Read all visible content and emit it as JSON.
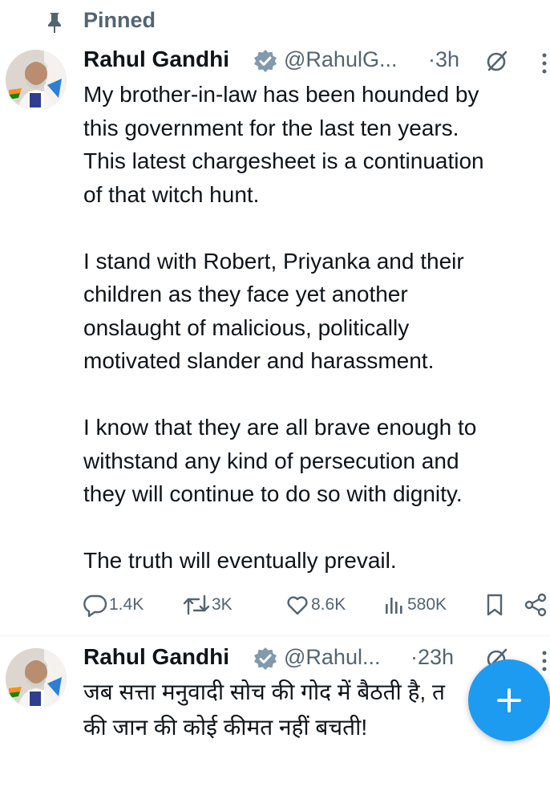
{
  "pinned_label": "Pinned",
  "tweets": [
    {
      "author_name": "Rahul Gandhi",
      "handle": "@RahulG...",
      "time": "·3h",
      "text": "My brother-in-law has been hounded by\nthis government for the last ten years.\nThis latest chargesheet is a continuation\nof that witch hunt.\n\nI stand with Robert, Priyanka and their\nchildren as they face yet another\nonslaught of malicious, politically\nmotivated slander and harassment.\n\nI know that they are all brave enough to\nwithstand any kind of persecution and\nthey will continue to do so with dignity.\n\nThe truth will eventually prevail.",
      "stats": {
        "replies": "1.4K",
        "reposts": "3K",
        "likes": "8.6K",
        "views": "580K"
      }
    },
    {
      "author_name": "Rahul Gandhi",
      "handle": "@Rahul...",
      "time": "·23h",
      "text_line1": "जब सत्ता मनुवादी सोच की गोद में बैठती है, त",
      "text_line2": "की जान की कोई कीमत नहीं बचती!"
    }
  ],
  "colors": {
    "accent": "#1d9bf0",
    "secondary_text": "#536471",
    "primary_text": "#0f1419",
    "verified_badge": "#829aab"
  },
  "icons": {
    "pinned": "pin-icon",
    "verified": "verified-badge-icon",
    "grok": "grok-icon",
    "more": "more-options-icon",
    "reply": "reply-icon",
    "repost": "repost-icon",
    "like": "like-icon",
    "views": "views-icon",
    "bookmark": "bookmark-icon",
    "share": "share-icon",
    "compose": "plus-icon"
  }
}
